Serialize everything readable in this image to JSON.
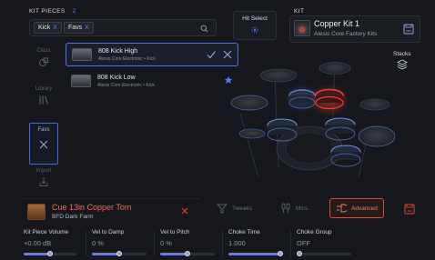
{
  "kit_pieces": {
    "title": "KIT PIECES",
    "count": "2",
    "filters": [
      {
        "label": "Kick",
        "remove": "X"
      },
      {
        "label": "Favs",
        "remove": "X"
      }
    ],
    "search_icon": "search-icon"
  },
  "side_nav": [
    {
      "label": "Class",
      "icon": "shapes-icon",
      "active": false
    },
    {
      "label": "Library",
      "icon": "library-icon",
      "active": false
    },
    {
      "label": "Favs",
      "icon": "close-icon",
      "active": true
    },
    {
      "label": "Import",
      "icon": "import-icon",
      "active": false
    }
  ],
  "results": [
    {
      "title": "808 Kick High",
      "subtitle": "Alesis Core Electronic • Kick",
      "selected": true
    },
    {
      "title": "808 Kick Low",
      "subtitle": "Alesis Core Electronic • Kick",
      "selected": false,
      "favorite": true
    }
  ],
  "hit_select": {
    "label": "Hit Select"
  },
  "kit": {
    "label": "KIT",
    "name": "Copper Kit 1",
    "subtitle": "Alesis Core Factory Kits"
  },
  "stacks": {
    "label": "Stacks"
  },
  "selected_piece": {
    "name": "Cue 13in Copper Tom",
    "subtitle": "BFD Dark Farm",
    "close": "x"
  },
  "tabs": [
    {
      "label": "Tweaks",
      "icon": "tweaks-icon",
      "active": false
    },
    {
      "label": "Mics",
      "icon": "mics-icon",
      "active": false
    },
    {
      "label": "Advanced",
      "icon": "advanced-icon",
      "active": true
    }
  ],
  "params": [
    {
      "label": "Kit Piece Volume",
      "value": "+0.00 dB",
      "fraction": 0.5
    },
    {
      "label": "Vel to Damp",
      "value": "0 %",
      "fraction": 0.5
    },
    {
      "label": "Vel to Pitch",
      "value": "0 %",
      "fraction": 0.5
    },
    {
      "label": "Choke Time",
      "value": "1.000",
      "fraction": 1.0
    },
    {
      "label": "Choke Group",
      "value": "OFF",
      "fraction": 0.0
    }
  ],
  "colors": {
    "background": "#15171c",
    "accent_blue": "#4f7ef7",
    "accent_red": "#e2483a",
    "piece_name": "#f16a52"
  }
}
